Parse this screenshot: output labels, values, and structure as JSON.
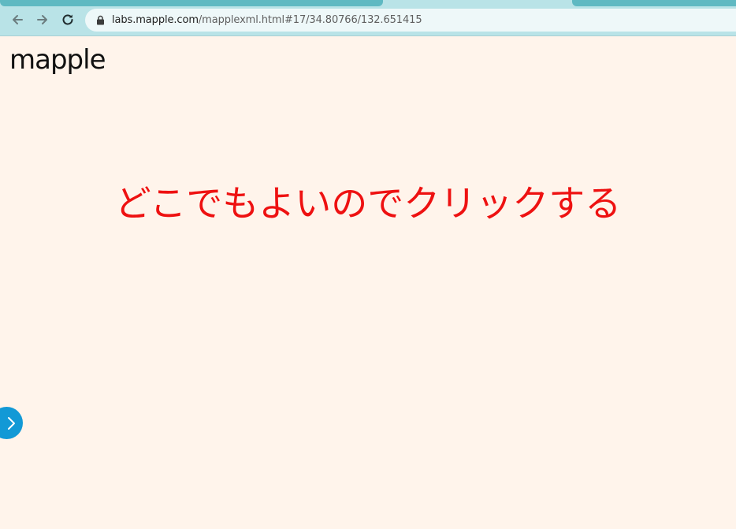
{
  "browser": {
    "url_host": "labs.mapple.com",
    "url_path": "/mapplexml.html#17/34.80766/132.651415",
    "back_icon": "arrow-left-icon",
    "forward_icon": "arrow-right-icon",
    "reload_icon": "reload-icon",
    "lock_icon": "lock-icon"
  },
  "page": {
    "logo_text": "mapple",
    "instruction": "どこでもよいのでクリックする",
    "toggle_icon": "chevron-right-icon"
  },
  "colors": {
    "chrome_bg": "#b9e3e7",
    "page_bg": "#fff4eb",
    "instruction": "#ee1111",
    "toggle_bg": "#1299d6"
  }
}
